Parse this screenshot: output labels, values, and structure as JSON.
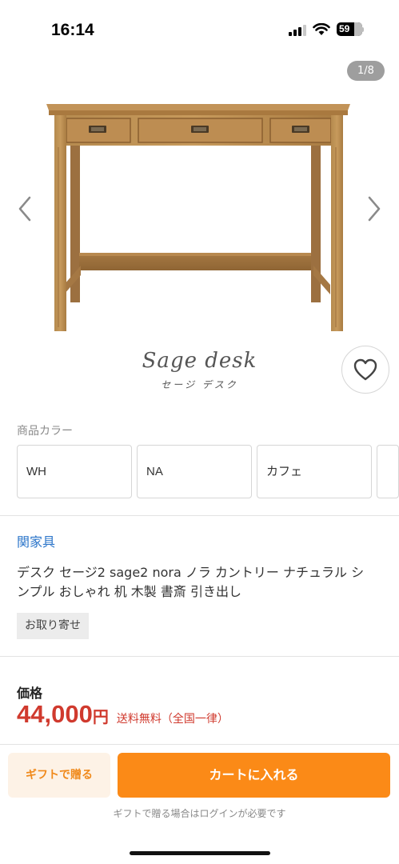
{
  "status_bar": {
    "time": "16:14",
    "battery": "59"
  },
  "gallery": {
    "counter": "1/8",
    "prev_icon": "chevron-left-icon",
    "next_icon": "chevron-right-icon"
  },
  "product": {
    "logo_main": "Sage desk",
    "logo_sub": "セージ デスク",
    "favorite_icon": "heart-icon",
    "color_label": "商品カラー",
    "colors": [
      "WH",
      "NA",
      "カフェ"
    ],
    "brand": "関家具",
    "title": "デスク セージ2 sage2 nora ノラ カントリー ナチュラル シンプル おしゃれ 机 木製 書斎 引き出し",
    "order_badge": "お取り寄せ",
    "price_label": "価格",
    "price": "44,000",
    "price_unit": "円",
    "shipping": "送料無料（全国一律）"
  },
  "actions": {
    "gift_label": "ギフトで贈る",
    "cart_label": "カートに入れる",
    "gift_note": "ギフトで贈る場合はログインが必要です"
  },
  "colors": {
    "accent": "#fb8a17",
    "price": "#d03a2e",
    "link": "#2a74c9"
  }
}
